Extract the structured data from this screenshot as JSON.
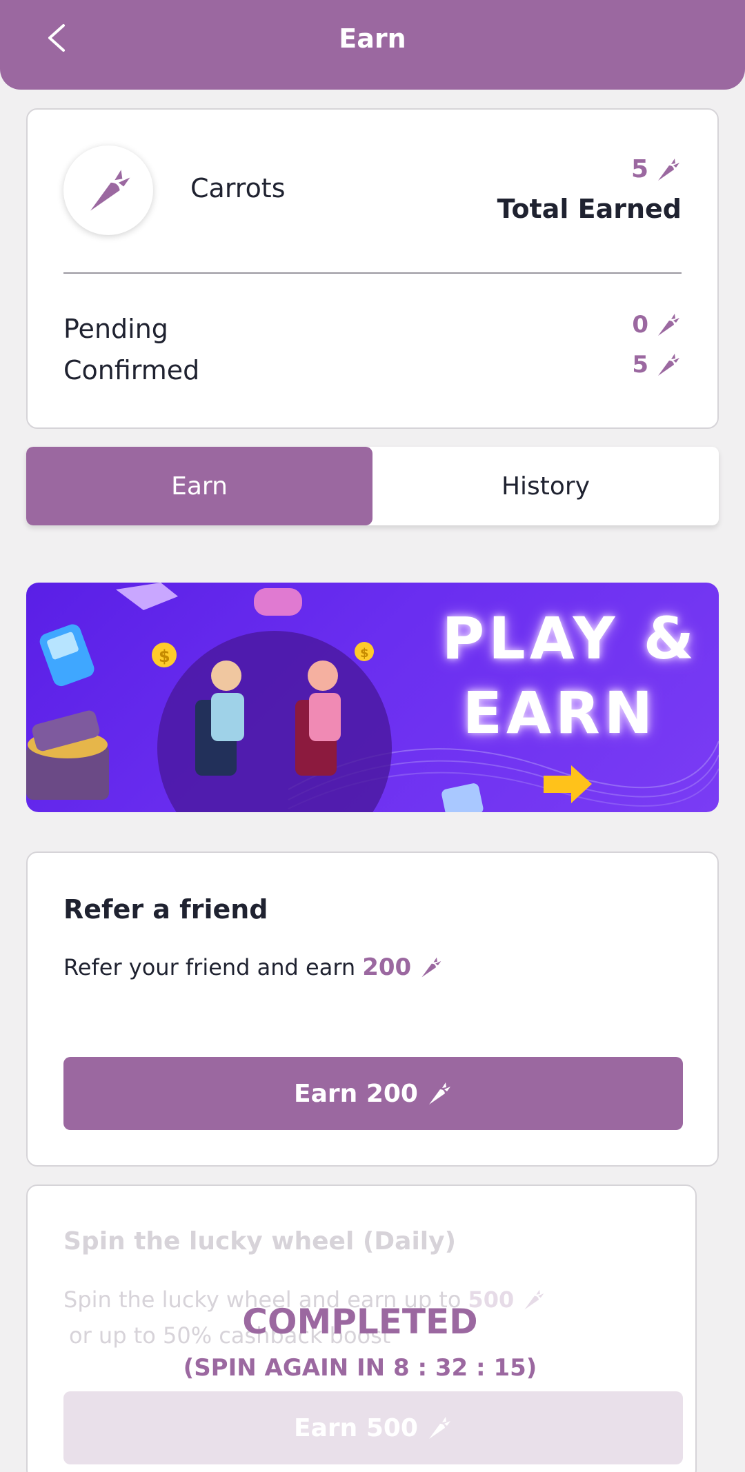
{
  "header": {
    "title": "Earn"
  },
  "summary": {
    "currency_label": "Carrots",
    "total_value": "5",
    "total_label": "Total Earned",
    "rows": [
      {
        "label": "Pending",
        "value": "0"
      },
      {
        "label": "Confirmed",
        "value": "5"
      }
    ]
  },
  "tabs": [
    {
      "label": "Earn",
      "active": true
    },
    {
      "label": "History",
      "active": false
    }
  ],
  "banner": {
    "line1": "PLAY &",
    "line2": "EARN"
  },
  "refer": {
    "title": "Refer a friend",
    "desc": "Refer your friend and earn",
    "amount": "200",
    "button_label": "Earn 200"
  },
  "spin": {
    "title": "Spin the lucky wheel (Daily)",
    "desc_line1": "Spin the lucky wheel and earn up to",
    "amount": "500",
    "desc_line2": "or up to 50% cashback boost",
    "button_label": "Earn 500",
    "status": "COMPLETED",
    "countdown": "(SPIN AGAIN IN 8 : 32 : 15)"
  },
  "colors": {
    "accent": "#9b68a0",
    "background": "#f1f0f1",
    "text": "#1f2230"
  },
  "icons": {
    "back": "chevron-left-icon",
    "carrot": "carrot-icon"
  }
}
